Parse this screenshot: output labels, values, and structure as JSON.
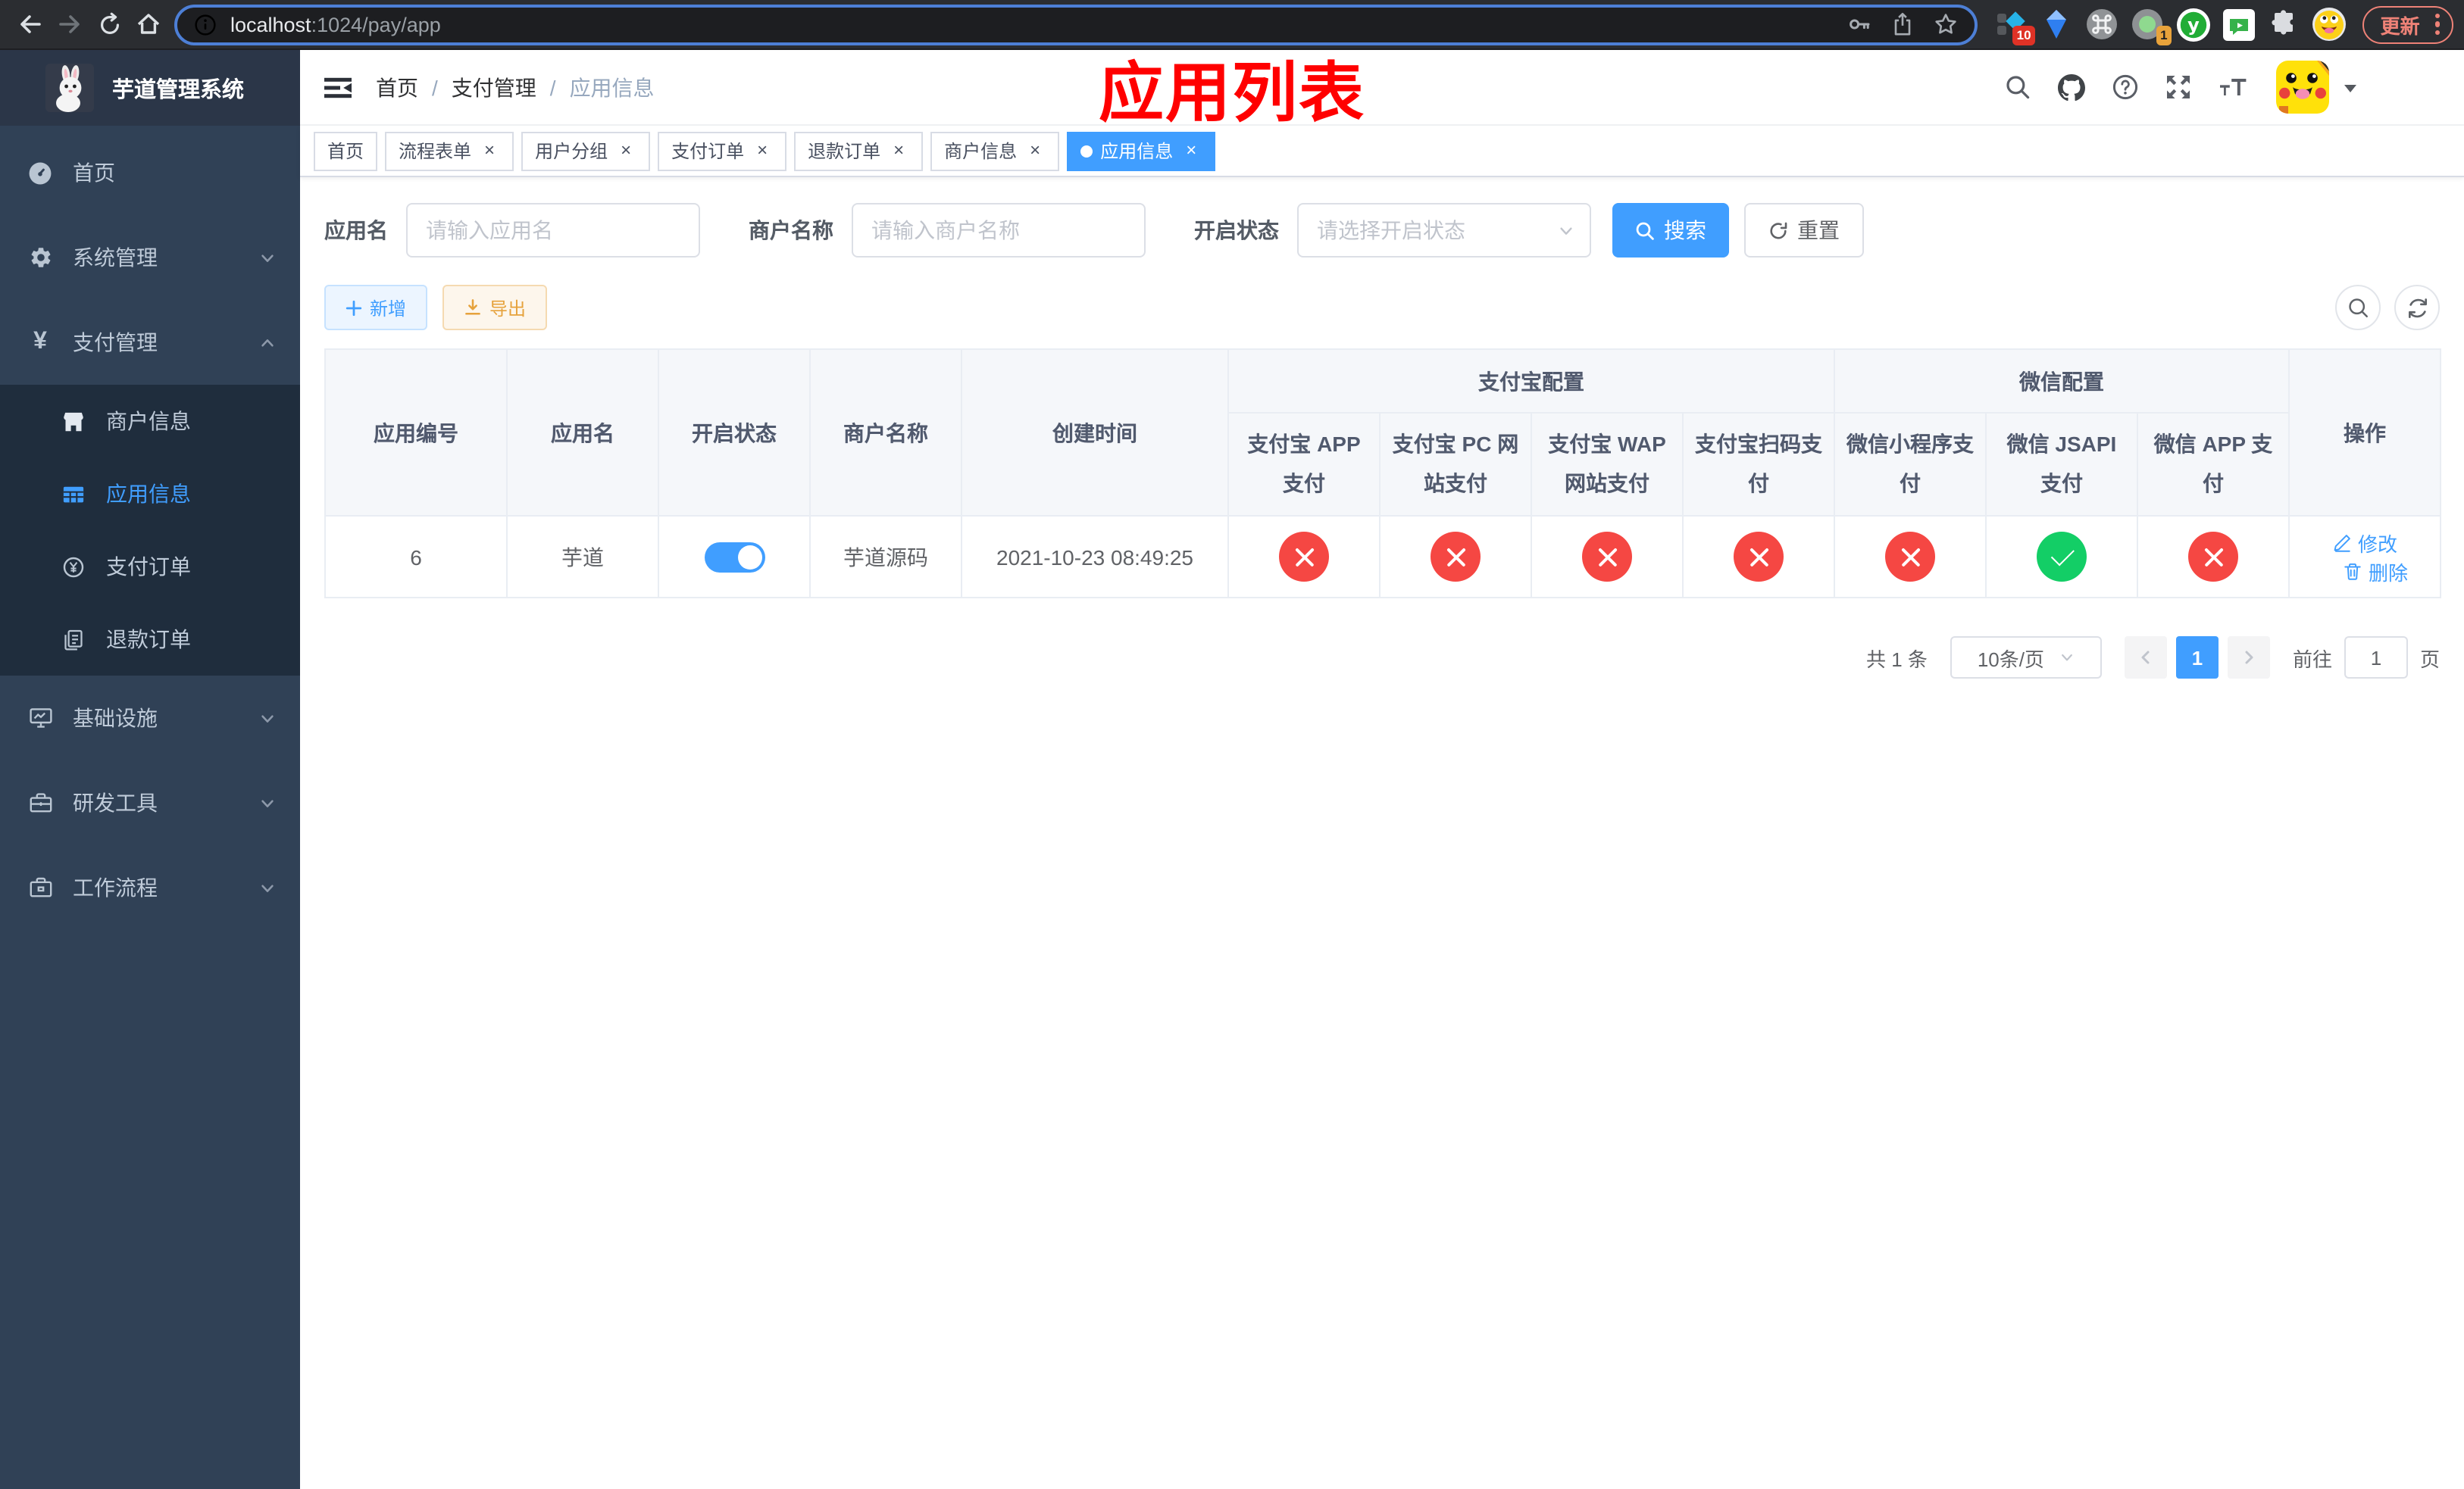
{
  "colors": {
    "accent": "#409eff",
    "success": "#13ce66",
    "danger": "#f54743",
    "warning": "#e6a23c",
    "annotation": "#ff0000",
    "update": "#ee8277",
    "sidebar_bg": "#304156",
    "submenu_bg": "#1f2d3d"
  },
  "browser": {
    "url_host": "localhost",
    "url_path": ":1024/pay/app",
    "ext_badge_blue": "10",
    "ext_badge_green": "1",
    "update_label": "更新"
  },
  "sidebar": {
    "title": "芋道管理系统",
    "items": [
      {
        "label": "首页"
      },
      {
        "label": "系统管理"
      },
      {
        "label": "支付管理"
      },
      {
        "label": "商户信息"
      },
      {
        "label": "应用信息"
      },
      {
        "label": "支付订单"
      },
      {
        "label": "退款订单"
      },
      {
        "label": "基础设施"
      },
      {
        "label": "研发工具"
      },
      {
        "label": "工作流程"
      }
    ]
  },
  "header": {
    "breadcrumb": [
      {
        "label": "首页"
      },
      {
        "label": "支付管理"
      },
      {
        "label": "应用信息"
      }
    ],
    "separator": "/",
    "annotation": "应用列表"
  },
  "tabs": [
    {
      "label": "首页"
    },
    {
      "label": "流程表单"
    },
    {
      "label": "用户分组"
    },
    {
      "label": "支付订单"
    },
    {
      "label": "退款订单"
    },
    {
      "label": "商户信息"
    },
    {
      "label": "应用信息"
    }
  ],
  "filters": {
    "app_name_label": "应用名",
    "app_name_placeholder": "请输入应用名",
    "merchant_label": "商户名称",
    "merchant_placeholder": "请输入商户名称",
    "status_label": "开启状态",
    "status_placeholder": "请选择开启状态",
    "search_button": "搜索",
    "reset_button": "重置"
  },
  "toolbar": {
    "add_button": "新增",
    "export_button": "导出"
  },
  "table": {
    "columns": {
      "app_id": "应用编号",
      "app_name": "应用名",
      "status": "开启状态",
      "merchant": "商户名称",
      "created": "创建时间",
      "alipay_group": "支付宝配置",
      "alipay_app": "支付宝 APP 支付",
      "alipay_pc": "支付宝 PC 网站支付",
      "alipay_wap": "支付宝 WAP 网站支付",
      "alipay_qr": "支付宝扫码支付",
      "wechat_group": "微信配置",
      "wechat_mini": "微信小程序支付",
      "wechat_jsapi": "微信 JSAPI 支付",
      "wechat_app": "微信 APP 支付",
      "ops": "操作"
    },
    "row": {
      "app_id": "6",
      "app_name": "芋道",
      "enabled": true,
      "merchant": "芋道源码",
      "created": "2021-10-23 08:49:25",
      "statuses": [
        "no",
        "no",
        "no",
        "no",
        "no",
        "yes",
        "no"
      ],
      "edit_label": "修改",
      "delete_label": "删除"
    }
  },
  "pagination": {
    "total": "共 1 条",
    "page_size": "10条/页",
    "current_page": "1",
    "goto_label": "前往",
    "goto_value": "1",
    "goto_unit": "页"
  }
}
